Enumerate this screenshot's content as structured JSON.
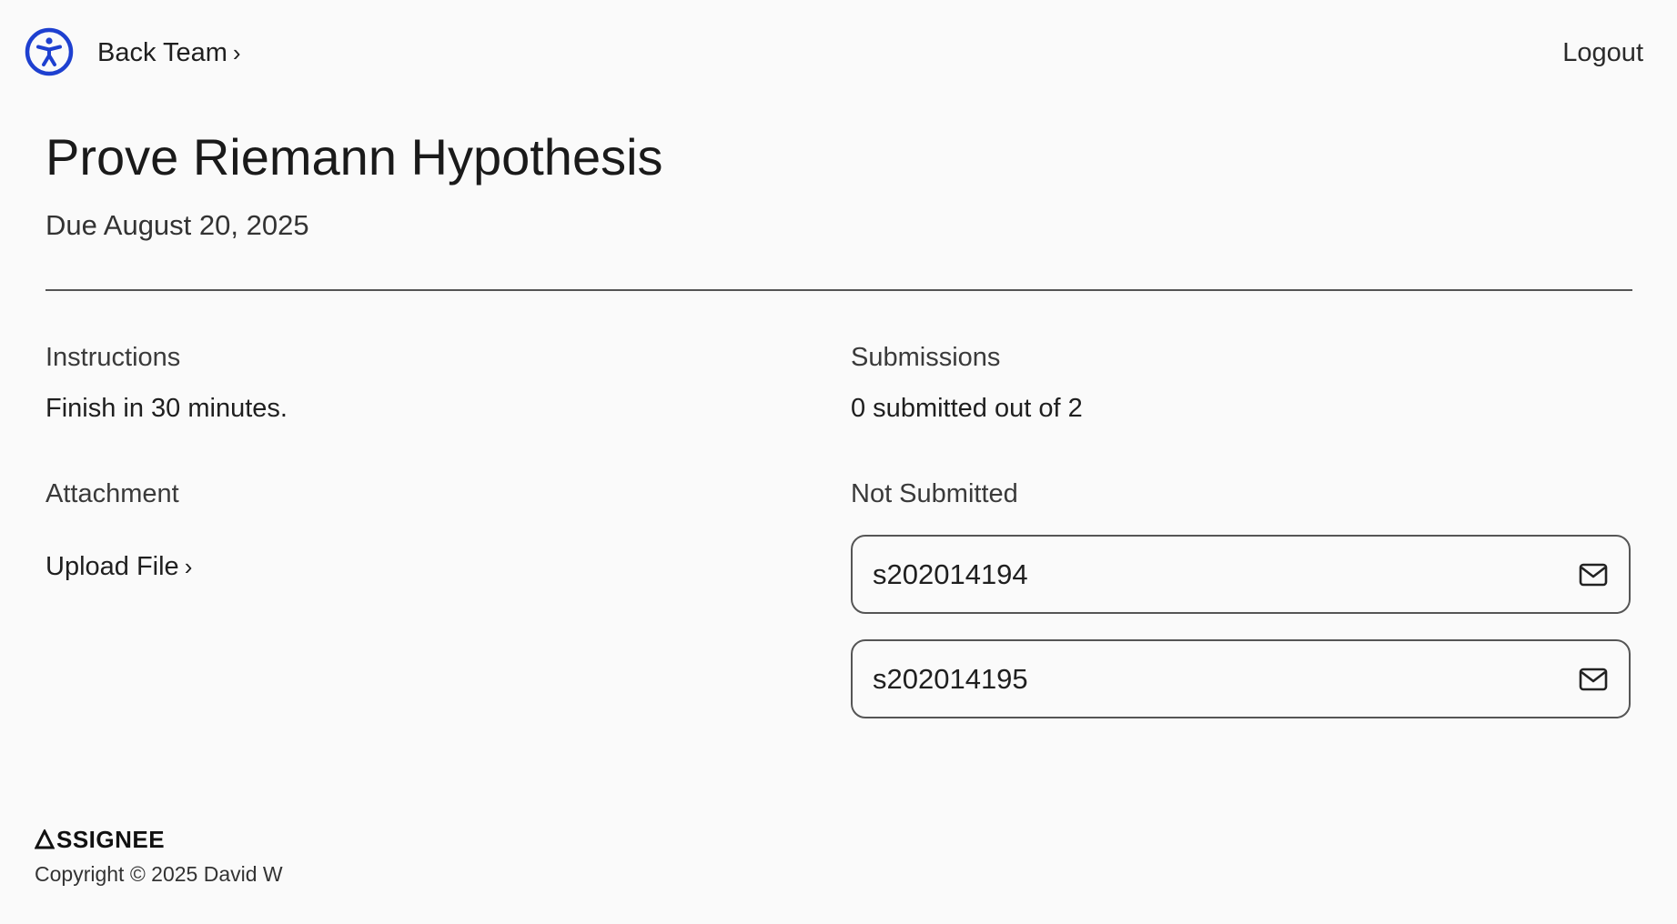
{
  "header": {
    "back_label": "Back Team",
    "back_chevron": "›",
    "logout_label": "Logout",
    "accessibility_icon": "accessibility-icon",
    "accent_color": "#1e40d0"
  },
  "assignment": {
    "title": "Prove Riemann Hypothesis",
    "due": "Due August 20, 2025"
  },
  "instructions": {
    "label": "Instructions",
    "text": "Finish in 30 minutes."
  },
  "attachment": {
    "label": "Attachment",
    "upload_label": "Upload File",
    "upload_chevron": "›"
  },
  "submissions": {
    "label": "Submissions",
    "summary": "0 submitted out of 2",
    "status_label": "Not Submitted",
    "students": [
      {
        "id": "s202014194",
        "icon": "mail-icon"
      },
      {
        "id": "s202014195",
        "icon": "mail-icon"
      }
    ]
  },
  "footer": {
    "brand": "SSIGNEE",
    "copyright": "Copyright © 2025 David W"
  }
}
